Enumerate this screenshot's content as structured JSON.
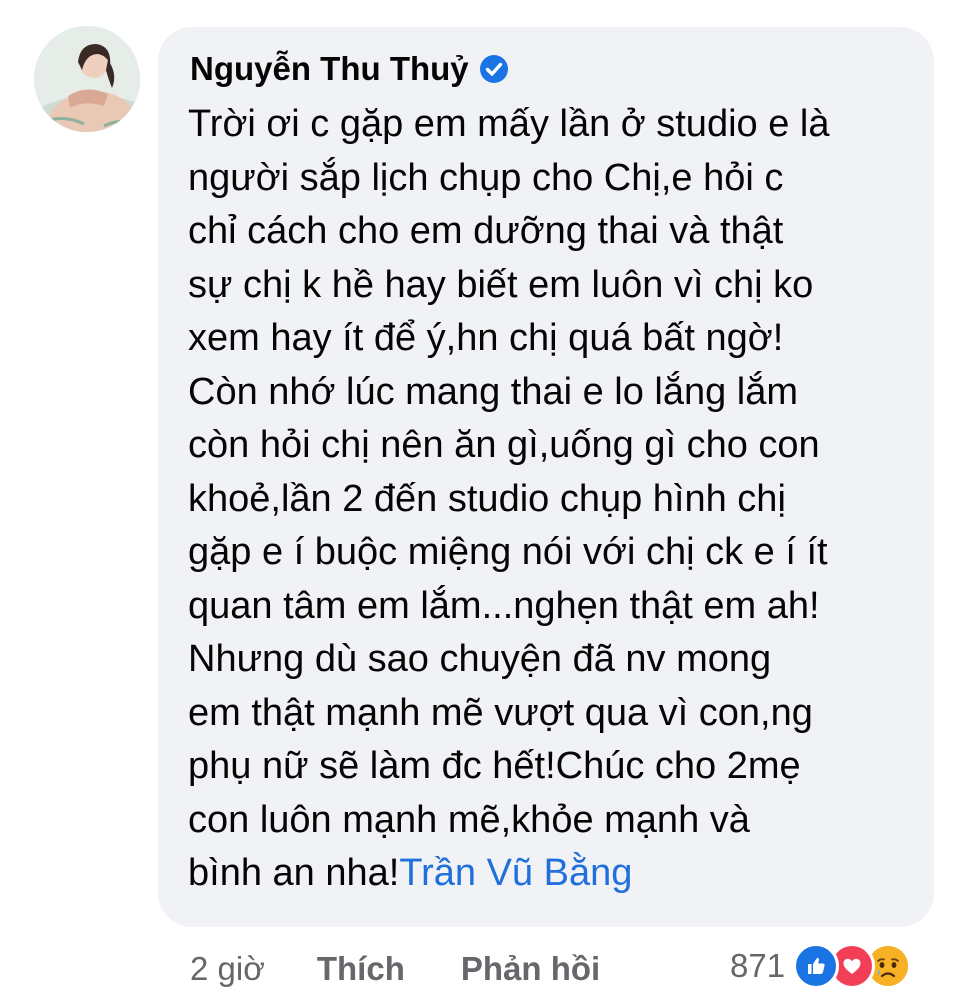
{
  "comment": {
    "author": "Nguyễn Thu Thuỷ",
    "verified": true,
    "verified_icon": "verified-badge-icon",
    "avatar_icon": "avatar-photo",
    "bubble_color": "#f0f2f5",
    "text_lines": [
      "Trời ơi c gặp em mấy lần ở studio e là",
      "người sắp lịch chụp cho Chị,e hỏi c",
      "chỉ cách cho em dưỡng thai và thật",
      "sự chị k hề hay biết em luôn vì chị ko",
      "xem hay ít để ý,hn chị quá bất ngờ!",
      "Còn nhớ lúc mang thai e lo lắng lắm",
      "còn hỏi chị nên ăn gì,uống gì cho con",
      "khoẻ,lần 2 đến studio chụp hình chị",
      "gặp e í buộc miệng nói với chị ck e í ít",
      "quan tâm em lắm...nghẹn thật em ah!",
      "Nhưng dù sao chuyện đã nv mong",
      "em thật mạnh mẽ vượt qua vì con,ng",
      "phụ nữ sẽ làm đc hết!Chúc cho 2mẹ",
      "con luôn mạnh mẽ,khỏe mạnh và"
    ],
    "last_line_prefix": "bình an nha!",
    "mention": "Trần Vũ Bằng",
    "mention_color": "#216fdb"
  },
  "actions": {
    "time": "2 giờ",
    "like_label": "Thích",
    "reply_label": "Phản hồi"
  },
  "reactions": {
    "count": "871",
    "icons": [
      "like-reaction-icon",
      "love-reaction-icon",
      "sad-reaction-icon"
    ]
  }
}
